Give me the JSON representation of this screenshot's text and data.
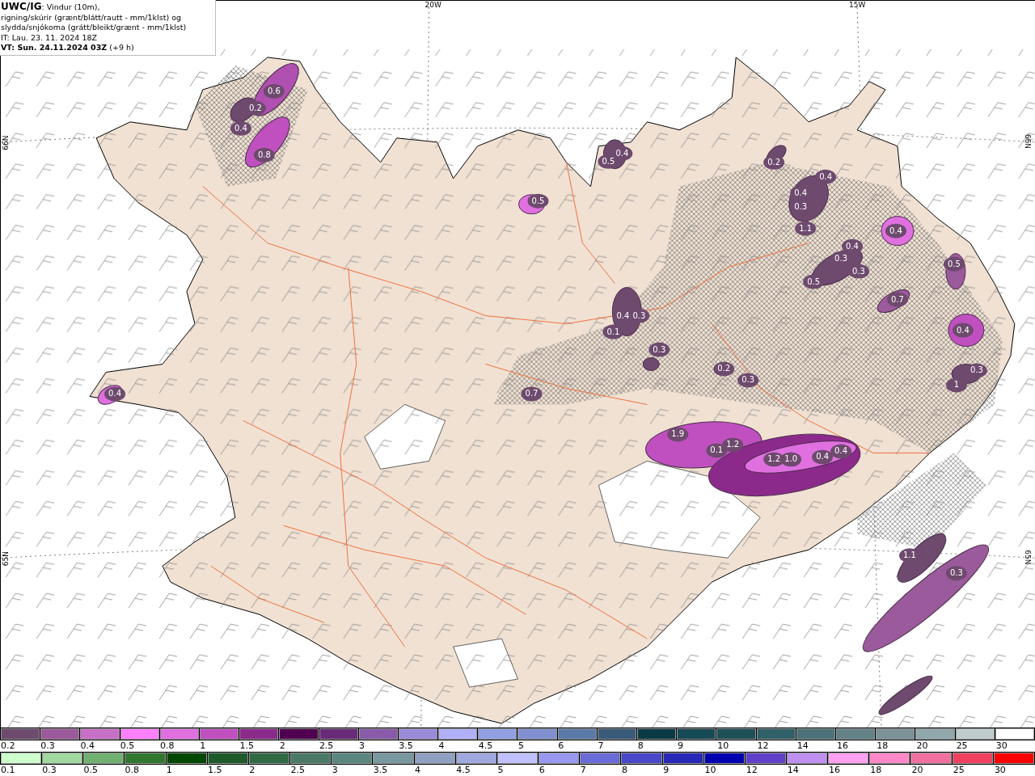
{
  "header": {
    "product": "UWC/IG",
    "description": ": Vindur (10m),\nrigning/skúrir (grænt/blátt/rautt - mm/1klst) og\nslydda/snjókoma (grátt/bleikt/grænt - mm/1klst)",
    "issue_time": "IT: Lau. 23. 11. 2024 18Z",
    "valid_time": "VT: Sun. 24.11.2024 03Z",
    "lead": " (+9 h)"
  },
  "map": {
    "longitude_labels": [
      "20W",
      "15W"
    ],
    "latitude_labels_left": [
      "66N",
      "65N"
    ],
    "latitude_labels_right": [
      "66N",
      "65N"
    ],
    "precip_labels": [
      "0.6",
      "0.2",
      "0.4",
      "0.8",
      "0.4",
      "0.5",
      "0.5",
      "0.4",
      "0.2",
      "0.4",
      "0.4",
      "0.3",
      "1.1",
      "0.4",
      "0.4",
      "0.3",
      "0.3",
      "0.5",
      "0.5",
      "0.7",
      "0.4",
      "0.3",
      "1",
      "0.4",
      "0.3",
      "0.1",
      "0.3",
      "0.2",
      "0.3",
      "0.7",
      "1.9",
      "0.1",
      "1.2",
      "1.2",
      "1.0",
      "0.4",
      "0.4",
      "1.1",
      "0.3"
    ]
  },
  "legend": {
    "snow_scale": [
      {
        "label": "0.2",
        "color": "#6e4a6e"
      },
      {
        "label": "0.3",
        "color": "#9b5a9b"
      },
      {
        "label": "0.4",
        "color": "#c870c8"
      },
      {
        "label": "0.5",
        "color": "#ff80ff"
      },
      {
        "label": "0.8",
        "color": "#e070e0"
      },
      {
        "label": "1",
        "color": "#c050c0"
      },
      {
        "label": "1.5",
        "color": "#8c2a8c"
      },
      {
        "label": "2",
        "color": "#500050"
      },
      {
        "label": "2.5",
        "color": "#6a2a7a"
      },
      {
        "label": "3",
        "color": "#8a5aaa"
      },
      {
        "label": "3.5",
        "color": "#9a8ad8"
      },
      {
        "label": "4",
        "color": "#b0b0f8"
      },
      {
        "label": "4.5",
        "color": "#90a0e0"
      },
      {
        "label": "5",
        "color": "#8090d0"
      },
      {
        "label": "6",
        "color": "#5a7aaa"
      },
      {
        "label": "7",
        "color": "#3a5a7a"
      },
      {
        "label": "8",
        "color": "#0a3a46"
      },
      {
        "label": "9",
        "color": "#164a56"
      },
      {
        "label": "10",
        "color": "#1e5058"
      },
      {
        "label": "12",
        "color": "#306068"
      },
      {
        "label": "14",
        "color": "#4a7278"
      },
      {
        "label": "16",
        "color": "#628288"
      },
      {
        "label": "18",
        "color": "#7a9298"
      },
      {
        "label": "20",
        "color": "#90a8ac"
      },
      {
        "label": "25",
        "color": "#c0cccc"
      },
      {
        "label": "30",
        "color": "#ffffff"
      }
    ],
    "rain_scale": [
      {
        "label": "0.1",
        "color": "#ccffcc"
      },
      {
        "label": "0.3",
        "color": "#a0d8a0"
      },
      {
        "label": "0.5",
        "color": "#70b070"
      },
      {
        "label": "0.8",
        "color": "#307830"
      },
      {
        "label": "1",
        "color": "#004800"
      },
      {
        "label": "1.5",
        "color": "#1e5a2a"
      },
      {
        "label": "2",
        "color": "#306a44"
      },
      {
        "label": "2.5",
        "color": "#4a7a66"
      },
      {
        "label": "3",
        "color": "#5a8880"
      },
      {
        "label": "3.5",
        "color": "#7898a0"
      },
      {
        "label": "4",
        "color": "#90a0c0"
      },
      {
        "label": "4.5",
        "color": "#a0a8e0"
      },
      {
        "label": "5",
        "color": "#c0c0ff"
      },
      {
        "label": "6",
        "color": "#9898f0"
      },
      {
        "label": "7",
        "color": "#6a6ad8"
      },
      {
        "label": "8",
        "color": "#4848c8"
      },
      {
        "label": "9",
        "color": "#2828b8"
      },
      {
        "label": "10",
        "color": "#0000b0"
      },
      {
        "label": "12",
        "color": "#6040c8"
      },
      {
        "label": "14",
        "color": "#c090f0"
      },
      {
        "label": "16",
        "color": "#ffa0f0"
      },
      {
        "label": "18",
        "color": "#ff88c8"
      },
      {
        "label": "20",
        "color": "#f070a0"
      },
      {
        "label": "25",
        "color": "#f04060"
      },
      {
        "label": "30",
        "color": "#ff0000"
      }
    ]
  }
}
